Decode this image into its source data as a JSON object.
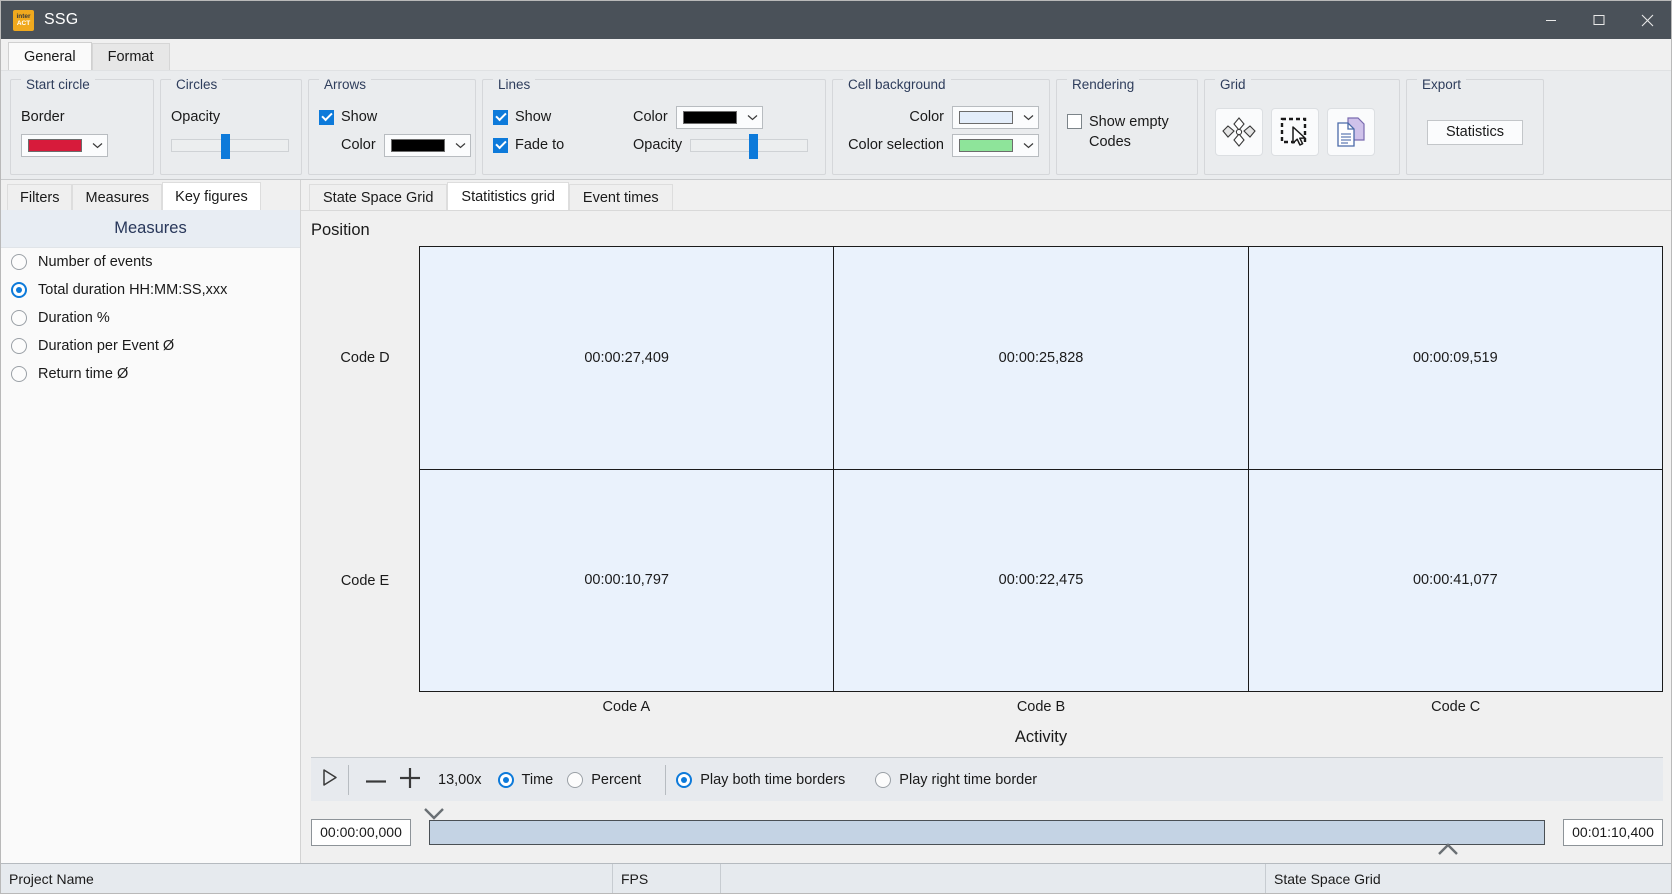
{
  "window": {
    "title": "SSG",
    "logo_top": "inter",
    "logo_bottom": "ACT",
    "minimize_icon": "minimize-icon",
    "maximize_icon": "maximize-icon",
    "close_icon": "close-icon"
  },
  "ribbon": {
    "tabs": [
      {
        "label": "General",
        "active": true
      },
      {
        "label": "Format",
        "active": false
      }
    ],
    "groups": {
      "start_circle": {
        "title": "Start circle",
        "border_label": "Border",
        "border_color": "#d71b3b"
      },
      "circles": {
        "title": "Circles",
        "opacity_label": "Opacity",
        "opacity_value": 42
      },
      "arrows": {
        "title": "Arrows",
        "show_label": "Show",
        "show_checked": true,
        "color_label": "Color",
        "color_value": "#000000"
      },
      "lines": {
        "title": "Lines",
        "show_label": "Show",
        "show_checked": true,
        "fade_label": "Fade to",
        "fade_checked": true,
        "color_label": "Color",
        "color_value": "#000000",
        "opacity_label": "Opacity",
        "opacity_value": 50
      },
      "cell_background": {
        "title": "Cell background",
        "color_label": "Color",
        "color_value": "#e3edfa",
        "selection_label": "Color selection",
        "selection_value": "#8ee49a"
      },
      "rendering": {
        "title": "Rendering",
        "show_empty_line1": "Show empty",
        "show_empty_line2": "Codes",
        "show_empty_checked": false
      },
      "grid": {
        "title": "Grid",
        "buttons": [
          {
            "icon": "diamond-cluster-icon"
          },
          {
            "icon": "marquee-select-icon"
          },
          {
            "icon": "copy-document-icon"
          }
        ]
      },
      "export": {
        "title": "Export",
        "statistics_label": "Statistics"
      }
    }
  },
  "left_panel": {
    "tabs": [
      {
        "label": "Filters",
        "active": false
      },
      {
        "label": "Measures",
        "active": false
      },
      {
        "label": "Key figures",
        "active": true
      }
    ],
    "header": "Measures",
    "options": [
      {
        "label": "Number of events",
        "selected": false
      },
      {
        "label": "Total duration HH:MM:SS,xxx",
        "selected": true
      },
      {
        "label": "Duration %",
        "selected": false
      },
      {
        "label": "Duration per Event Ø",
        "selected": false
      },
      {
        "label": "Return time Ø",
        "selected": false
      }
    ]
  },
  "content": {
    "tabs": [
      {
        "label": "State Space Grid",
        "active": false
      },
      {
        "label": "Statitistics grid",
        "active": true
      },
      {
        "label": "Event times",
        "active": false
      }
    ]
  },
  "chart_data": {
    "type": "heatmap",
    "title": "",
    "ylabel": "Position",
    "xlabel": "Activity",
    "row_labels": [
      "Code D",
      "Code E"
    ],
    "column_labels": [
      "Code A",
      "Code B",
      "Code C"
    ],
    "cell_values": [
      [
        "00:00:27,409",
        "00:00:25,828",
        "00:00:09,519"
      ],
      [
        "00:00:10,797",
        "00:00:22,475",
        "00:00:41,077"
      ]
    ],
    "cell_color": "#eaf2fc",
    "grid": true,
    "legend": "none"
  },
  "playback": {
    "play_icon": "play-icon",
    "minus_icon": "minus-icon",
    "plus_icon": "plus-icon",
    "zoom_value": "13,00x",
    "mode_options": [
      {
        "label": "Time",
        "selected": true
      },
      {
        "label": "Percent",
        "selected": false
      }
    ],
    "border_options": [
      {
        "label": "Play both time borders",
        "selected": true
      },
      {
        "label": "Play right time border",
        "selected": false
      }
    ]
  },
  "timeline": {
    "start_time": "00:00:00,000",
    "end_time": "00:01:10,400",
    "left_marker_icon": "chevron-down-icon",
    "right_marker_icon": "chevron-up-icon"
  },
  "statusbar": {
    "project_name": "Project Name",
    "fps_label": "FPS",
    "fps_value": "",
    "mode": "State Space Grid"
  }
}
